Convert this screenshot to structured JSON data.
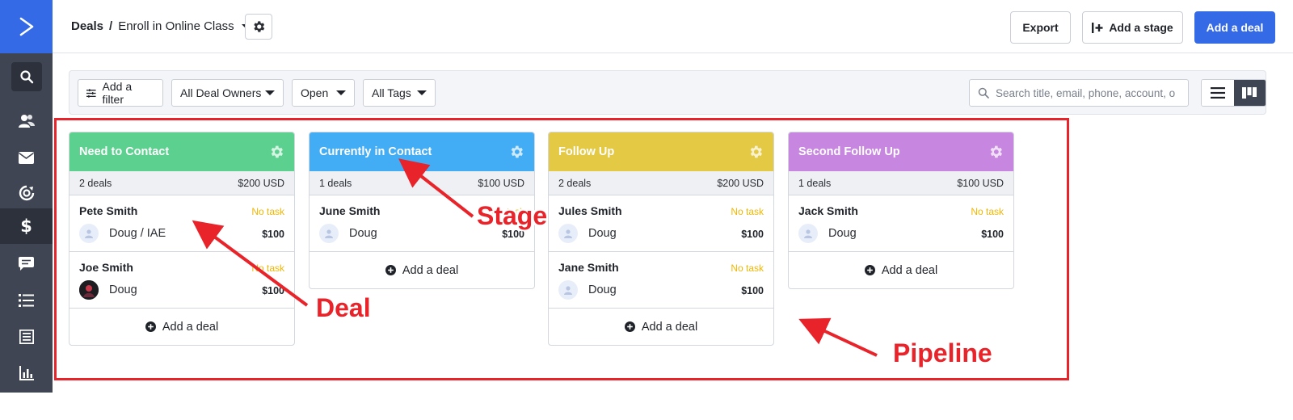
{
  "sidebar": {
    "logo_icon": "chevron-right-logo-icon",
    "items": [
      {
        "name": "search",
        "icon": "search-icon"
      },
      {
        "name": "contacts",
        "icon": "contacts-icon"
      },
      {
        "name": "campaigns",
        "icon": "envelope-icon"
      },
      {
        "name": "automations",
        "icon": "automation-icon"
      },
      {
        "name": "deals",
        "icon": "dollar-icon",
        "active": true
      },
      {
        "name": "conversations",
        "icon": "chat-icon"
      },
      {
        "name": "lists",
        "icon": "list-icon"
      },
      {
        "name": "forms",
        "icon": "form-icon"
      },
      {
        "name": "reports",
        "icon": "bar-chart-icon"
      }
    ]
  },
  "header": {
    "breadcrumb_root": "Deals",
    "breadcrumb_sep": "/",
    "pipeline_name": "Enroll in Online Class",
    "export_label": "Export",
    "add_stage_label": "Add a stage",
    "add_deal_label": "Add a deal"
  },
  "filters": {
    "add_filter_label": "Add a filter",
    "owners_value": "All Deal Owners",
    "status_value": "Open",
    "tags_value": "All Tags",
    "search_placeholder": "Search title, email, phone, account, o"
  },
  "stages": [
    {
      "title": "Need to Contact",
      "color": "#5cd18f",
      "count": "2 deals",
      "total": "$200 USD",
      "deals": [
        {
          "title": "Pete Smith",
          "task": "No task",
          "owner": "Doug / IAE",
          "value": "$100",
          "avatar": "default"
        },
        {
          "title": "Joe Smith",
          "task": "No task",
          "owner": "Doug",
          "value": "$100",
          "avatar": "photo"
        }
      ],
      "add_label": "Add a deal"
    },
    {
      "title": "Currently in Contact",
      "color": "#42adf5",
      "count": "1 deals",
      "total": "$100 USD",
      "deals": [
        {
          "title": "June Smith",
          "task": "No task",
          "owner": "Doug",
          "value": "$100",
          "avatar": "default"
        }
      ],
      "add_label": "Add a deal"
    },
    {
      "title": "Follow Up",
      "color": "#e3c944",
      "count": "2 deals",
      "total": "$200 USD",
      "deals": [
        {
          "title": "Jules Smith",
          "task": "No task",
          "owner": "Doug",
          "value": "$100",
          "avatar": "default"
        },
        {
          "title": "Jane Smith",
          "task": "No task",
          "owner": "Doug",
          "value": "$100",
          "avatar": "default"
        }
      ],
      "add_label": "Add a deal"
    },
    {
      "title": "Second Follow Up",
      "color": "#c786e0",
      "count": "1 deals",
      "total": "$100 USD",
      "deals": [
        {
          "title": "Jack Smith",
          "task": "No task",
          "owner": "Doug",
          "value": "$100",
          "avatar": "default"
        }
      ],
      "add_label": "Add a deal"
    }
  ],
  "annotations": {
    "stage_label": "Stage",
    "deal_label": "Deal",
    "pipeline_label": "Pipeline",
    "color": "#e8232a"
  }
}
